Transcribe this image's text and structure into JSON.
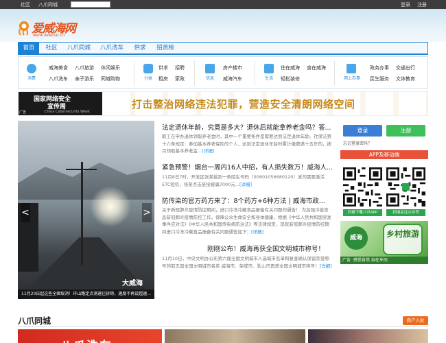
{
  "topbar": {
    "links": [
      "社区",
      "八爪同城"
    ],
    "right": [
      "登录",
      "注册"
    ]
  },
  "logo": {
    "name": "爱威海网",
    "url": "www.iweihai.cn"
  },
  "nav": {
    "items": [
      "首页",
      "社区",
      "八爪同城",
      "八爪洗车",
      "供求",
      "招贤榜"
    ],
    "active": 0
  },
  "categories": [
    {
      "label": "消费",
      "icon": "chat-bubble-icon",
      "color": "#4aa6ea",
      "links": [
        "威海美食",
        "八爪旅游",
        "休闲娱乐",
        "八爪洗车",
        "亲子游乐",
        "同城购物"
      ]
    },
    {
      "label": "分类",
      "icon": "wallet-icon",
      "color": "#4aa6ea",
      "links": [
        "供求",
        "招聘",
        "租房",
        "家政"
      ]
    },
    {
      "label": "信息",
      "icon": "grid-icon",
      "color": "#4aa6ea",
      "links": [
        "房产楼市",
        "威海汽车"
      ]
    },
    {
      "label": "生活",
      "icon": "grid-icon",
      "color": "#4aa6ea",
      "links": [
        "住在威海",
        "食在威海",
        "轻松装修"
      ]
    },
    {
      "label": "网上办事",
      "icon": "grid-icon",
      "color": "#4aa6ea",
      "links": [
        "政务办事",
        "交通出行",
        "民生服务",
        "文体教育"
      ]
    }
  ],
  "banner": {
    "left_title": "国家网络安全",
    "left_sub": "宣传周",
    "left_en": "China Cybersecurity Week",
    "ad_tag": "广告",
    "slogan": "打击整治网络违法犯罪，营造安全清朗网络空间"
  },
  "slideshow": {
    "caption": "11月20日起这些全面取消！环山路定点测速已拆除，速度不再设超速...",
    "watermark": "大威海",
    "prev": "<",
    "next": ">"
  },
  "articles": [
    {
      "title": "法定退休年龄，究竟是多大？退休后就能拿养老金吗？答...",
      "body": "职工在申办退休领取养老金时，其中一个重要条件是需要达到法定退休年龄。社保法第十六条规定：参加基本养老保险的个人，达到法定退休年龄时累计缴费满十五年的，按月领取基本养老金...",
      "more": "[详细]"
    },
    {
      "title": "紧急预警！烟台一周内16人中招，有人损失数万！威海人...",
      "body": "11月8日7时，开发区张某接到一条陌生号码（00601056680120）发的需要激活ETC短信，张某点击链接被骗7000元...",
      "more": "[详细]"
    },
    {
      "title": "防传染的官方药方来了：8个药方+6种方法 | 威海市政...",
      "body": "关于新冠肺炎疫情防控期间，进口冷冻冷藏食品报备有关问题的通告！ 为加强冷链食品新冠肺炎疫情防控工作，保障公众生命安全和身体健康，根据《中华人民共和国突发事件应对法》《中华人民共和国传染病防治法》等法律规定，现就新冠肺炎疫情防控期间进口冷冻冷藏食品报备有关问题通告如下：",
      "more": "[详细]"
    },
    {
      "title": "刚刚公布！威海再获全国文明城市称号！",
      "body": "11月10日，中央文明办公布第六届全国文明城市入选城市名单和复查确认保留荣誉称号的前五届全国文明城市名单 威海市、荣成市、乳山市再获全国文明城市称号！",
      "more": "[详细]"
    }
  ],
  "login": {
    "login": "登录",
    "register": "注册",
    "forgot": "忘记登录密码？",
    "colors": {
      "login": "#3a7fd4",
      "register": "#3fbf5a"
    }
  },
  "app": {
    "title": "APP及移动端",
    "btn1": "扫描下载八爪APP",
    "btn2": "扫描关注公众号"
  },
  "side_ad": {
    "left": "威海",
    "right": "乡村旅游",
    "foot": "感受自然  自在乡间",
    "tag": "广告"
  },
  "section": {
    "title": "八爪同城",
    "merchant": "商户入驻",
    "thumb_text": "八爪洗车"
  }
}
